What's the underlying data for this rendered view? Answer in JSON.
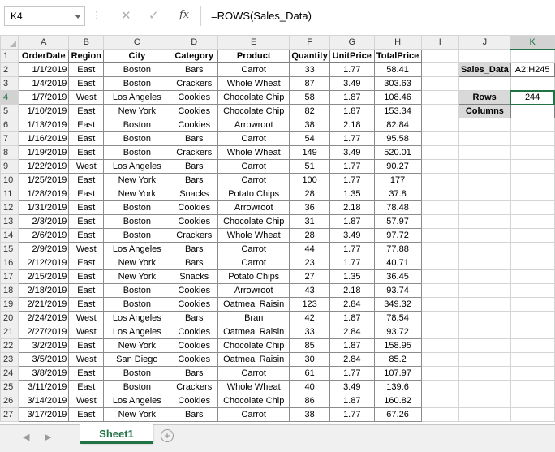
{
  "name_box": {
    "value": "K4"
  },
  "formula_bar": {
    "formula": "=ROWS(Sales_Data)",
    "cancel_icon": "✕",
    "enter_icon": "✓",
    "fx_label": "fx"
  },
  "columns": [
    "A",
    "B",
    "C",
    "D",
    "E",
    "F",
    "G",
    "H",
    "I",
    "J",
    "K"
  ],
  "headers": [
    "OrderDate",
    "Region",
    "City",
    "Category",
    "Product",
    "Quantity",
    "UnitPrice",
    "TotalPrice"
  ],
  "rows": [
    [
      "1/1/2019",
      "East",
      "Boston",
      "Bars",
      "Carrot",
      "33",
      "1.77",
      "58.41"
    ],
    [
      "1/4/2019",
      "East",
      "Boston",
      "Crackers",
      "Whole Wheat",
      "87",
      "3.49",
      "303.63"
    ],
    [
      "1/7/2019",
      "West",
      "Los Angeles",
      "Cookies",
      "Chocolate Chip",
      "58",
      "1.87",
      "108.46"
    ],
    [
      "1/10/2019",
      "East",
      "New York",
      "Cookies",
      "Chocolate Chip",
      "82",
      "1.87",
      "153.34"
    ],
    [
      "1/13/2019",
      "East",
      "Boston",
      "Cookies",
      "Arrowroot",
      "38",
      "2.18",
      "82.84"
    ],
    [
      "1/16/2019",
      "East",
      "Boston",
      "Bars",
      "Carrot",
      "54",
      "1.77",
      "95.58"
    ],
    [
      "1/19/2019",
      "East",
      "Boston",
      "Crackers",
      "Whole Wheat",
      "149",
      "3.49",
      "520.01"
    ],
    [
      "1/22/2019",
      "West",
      "Los Angeles",
      "Bars",
      "Carrot",
      "51",
      "1.77",
      "90.27"
    ],
    [
      "1/25/2019",
      "East",
      "New York",
      "Bars",
      "Carrot",
      "100",
      "1.77",
      "177"
    ],
    [
      "1/28/2019",
      "East",
      "New York",
      "Snacks",
      "Potato Chips",
      "28",
      "1.35",
      "37.8"
    ],
    [
      "1/31/2019",
      "East",
      "Boston",
      "Cookies",
      "Arrowroot",
      "36",
      "2.18",
      "78.48"
    ],
    [
      "2/3/2019",
      "East",
      "Boston",
      "Cookies",
      "Chocolate Chip",
      "31",
      "1.87",
      "57.97"
    ],
    [
      "2/6/2019",
      "East",
      "Boston",
      "Crackers",
      "Whole Wheat",
      "28",
      "3.49",
      "97.72"
    ],
    [
      "2/9/2019",
      "West",
      "Los Angeles",
      "Bars",
      "Carrot",
      "44",
      "1.77",
      "77.88"
    ],
    [
      "2/12/2019",
      "East",
      "New York",
      "Bars",
      "Carrot",
      "23",
      "1.77",
      "40.71"
    ],
    [
      "2/15/2019",
      "East",
      "New York",
      "Snacks",
      "Potato Chips",
      "27",
      "1.35",
      "36.45"
    ],
    [
      "2/18/2019",
      "East",
      "Boston",
      "Cookies",
      "Arrowroot",
      "43",
      "2.18",
      "93.74"
    ],
    [
      "2/21/2019",
      "East",
      "Boston",
      "Cookies",
      "Oatmeal Raisin",
      "123",
      "2.84",
      "349.32"
    ],
    [
      "2/24/2019",
      "West",
      "Los Angeles",
      "Bars",
      "Bran",
      "42",
      "1.87",
      "78.54"
    ],
    [
      "2/27/2019",
      "West",
      "Los Angeles",
      "Cookies",
      "Oatmeal Raisin",
      "33",
      "2.84",
      "93.72"
    ],
    [
      "3/2/2019",
      "East",
      "New York",
      "Cookies",
      "Chocolate Chip",
      "85",
      "1.87",
      "158.95"
    ],
    [
      "3/5/2019",
      "West",
      "San Diego",
      "Cookies",
      "Oatmeal Raisin",
      "30",
      "2.84",
      "85.2"
    ],
    [
      "3/8/2019",
      "East",
      "Boston",
      "Bars",
      "Carrot",
      "61",
      "1.77",
      "107.97"
    ],
    [
      "3/11/2019",
      "East",
      "Boston",
      "Crackers",
      "Whole Wheat",
      "40",
      "3.49",
      "139.6"
    ],
    [
      "3/14/2019",
      "West",
      "Los Angeles",
      "Cookies",
      "Chocolate Chip",
      "86",
      "1.87",
      "160.82"
    ],
    [
      "3/17/2019",
      "East",
      "New York",
      "Bars",
      "Carrot",
      "38",
      "1.77",
      "67.26"
    ]
  ],
  "side": {
    "sales_data_label": "Sales_Data",
    "sales_data_value": "A2:H245",
    "rows_label": "Rows",
    "rows_value": "244",
    "columns_label": "Columns",
    "columns_value": ""
  },
  "selected_cell": {
    "column": "K",
    "row": 4
  },
  "sheet_tabs": [
    {
      "name": "Sheet1",
      "active": true
    }
  ],
  "nav": {
    "prev_icon": "◀",
    "next_icon": "▶",
    "add_sheet_icon": "+"
  },
  "colors": {
    "accent": "#217346",
    "header_bg": "#efefef",
    "label_bg": "#d9d9d9"
  }
}
